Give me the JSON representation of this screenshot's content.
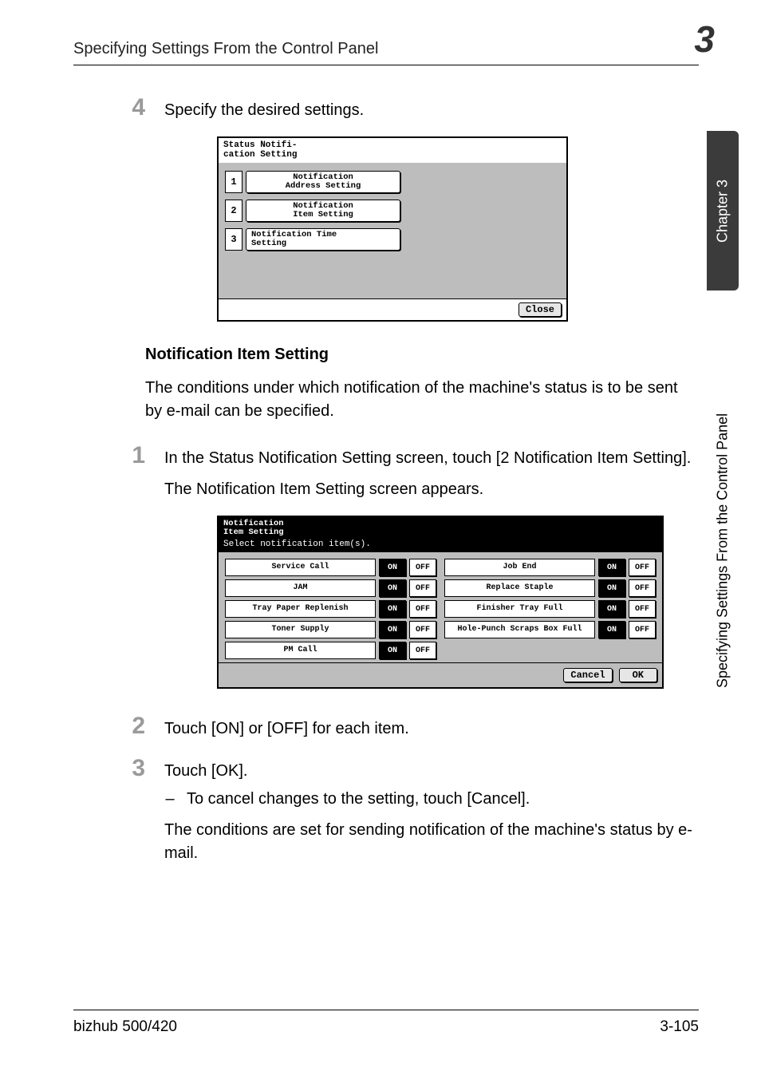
{
  "header": {
    "running_title": "Specifying Settings From the Control Panel",
    "chapter_num": "3"
  },
  "sidebar": {
    "chapter_tab": "Chapter 3",
    "long_tab": "Specifying Settings From the Control Panel"
  },
  "intro_step": {
    "num": "4",
    "text": "Specify the desired settings."
  },
  "lcd1": {
    "title_l1": "Status Notifi-",
    "title_l2": "cation Setting",
    "rows": [
      {
        "idx": "1",
        "label_l1": "Notification",
        "label_l2": "Address Setting"
      },
      {
        "idx": "2",
        "label_l1": "Notification",
        "label_l2": "Item Setting"
      },
      {
        "idx": "3",
        "label_l1": "Notification Time",
        "label_l2": "Setting"
      }
    ],
    "close": "Close"
  },
  "section": {
    "heading": "Notification Item Setting",
    "para": "The conditions under which notification of the machine's status is to be sent by e-mail can be specified."
  },
  "step1": {
    "num": "1",
    "text": "In the Status Notification Setting screen, touch [2 Notification Item Setting].",
    "sub": "The Notification Item Setting screen appears."
  },
  "lcd2": {
    "head_l1": "Notification",
    "head_l2": "Item Setting",
    "subhead": "Select notification item(s).",
    "on": "ON",
    "off": "OFF",
    "left_items": [
      "Service Call",
      "JAM",
      "Tray Paper\nReplenish",
      "Toner Supply",
      "PM Call"
    ],
    "right_items": [
      "Job End",
      "Replace\nStaple",
      "Finisher Tray\nFull",
      "Hole-Punch\nScraps Box Full"
    ],
    "cancel": "Cancel",
    "ok": "OK"
  },
  "step2": {
    "num": "2",
    "text": "Touch [ON] or [OFF] for each item."
  },
  "step3": {
    "num": "3",
    "text": "Touch [OK].",
    "dash": "To cancel changes to the setting, touch [Cancel].",
    "after": "The conditions are set for sending notification of the machine's status by e-mail."
  },
  "footer": {
    "left": "bizhub 500/420",
    "right": "3-105"
  }
}
